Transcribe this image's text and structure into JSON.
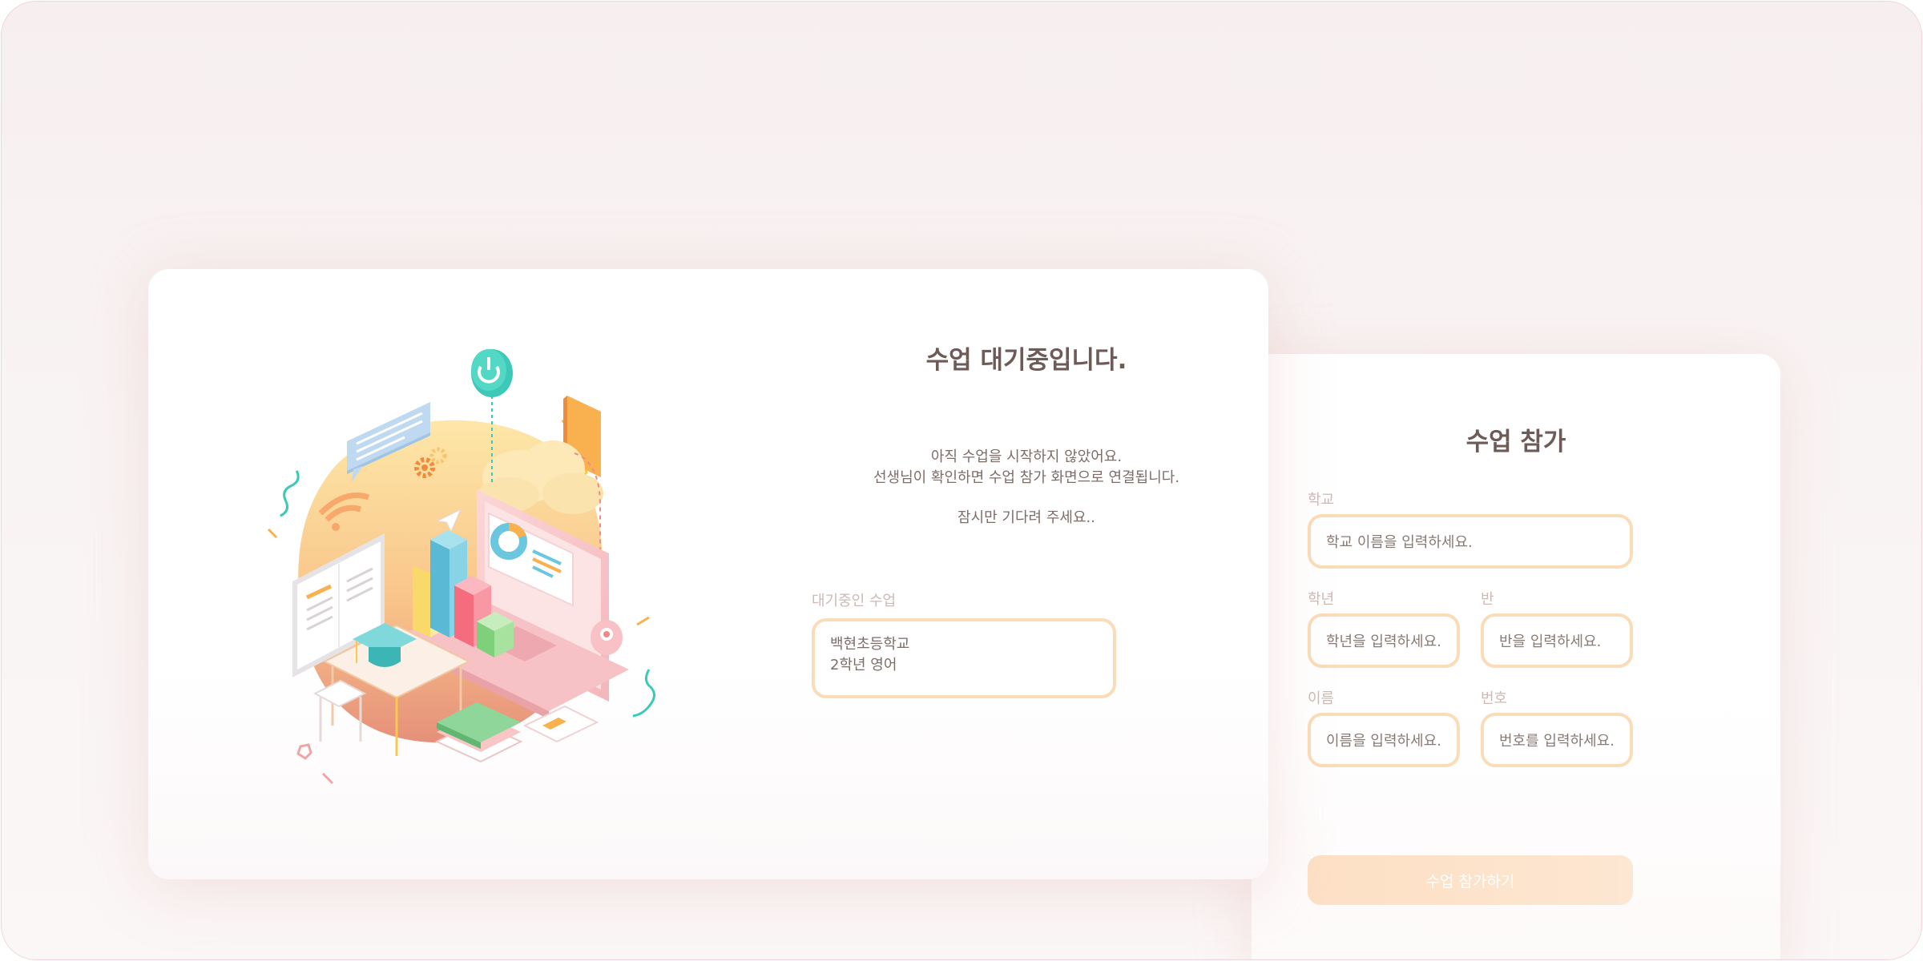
{
  "waiting": {
    "title": "수업 대기중입니다.",
    "line1": "아직 수업을 시작하지 않았어요.",
    "line2": "선생님이 확인하면 수업 참가 화면으로 연결됩니다.",
    "line3": "잠시만 기다려 주세요..",
    "class_label": "대기중인 수업",
    "class_school": "백현초등학교",
    "class_name": "2학년 영어"
  },
  "join": {
    "title": "수업 참가",
    "school_label": "학교",
    "school_placeholder": "학교 이름을 입력하세요.",
    "grade_label": "학년",
    "grade_placeholder": "학년을 입력하세요.",
    "class_label": "반",
    "class_placeholder": "반을 입력하세요.",
    "name_label": "이름",
    "name_placeholder": "이름을 입력하세요.",
    "number_label": "번호",
    "number_placeholder": "번호를 입력하세요.",
    "submit_label": "수업 참가하기"
  },
  "colors": {
    "accent_border": "#fbdcb8",
    "title_text": "#6e5b57",
    "teal": "#3cc9b8",
    "button": "#fde0c4"
  },
  "icons": [
    "power-icon",
    "gear-icon",
    "wifi-icon",
    "paper-plane-icon",
    "graduation-cap-icon",
    "cloud-icon"
  ]
}
